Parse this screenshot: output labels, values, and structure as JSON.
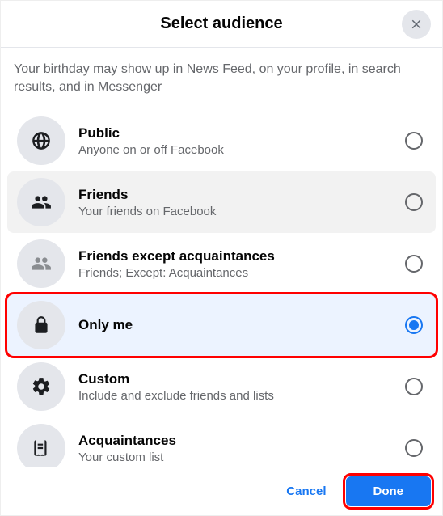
{
  "header": {
    "title": "Select audience"
  },
  "description": "Your birthday may show up in News Feed, on your profile, in search results, and in Messenger",
  "options": [
    {
      "icon": "globe-icon",
      "title": "Public",
      "sub": "Anyone on or off Facebook"
    },
    {
      "icon": "friends-icon",
      "title": "Friends",
      "sub": "Your friends on Facebook"
    },
    {
      "icon": "friends-except-icon",
      "title": "Friends except acquaintances",
      "sub": "Friends; Except: Acquaintances"
    },
    {
      "icon": "lock-icon",
      "title": "Only me",
      "sub": ""
    },
    {
      "icon": "gear-icon",
      "title": "Custom",
      "sub": "Include and exclude friends and lists"
    },
    {
      "icon": "list-icon",
      "title": "Acquaintances",
      "sub": "Your custom list"
    }
  ],
  "selected_index": 3,
  "hover_index": 1,
  "footer": {
    "cancel": "Cancel",
    "done": "Done"
  }
}
